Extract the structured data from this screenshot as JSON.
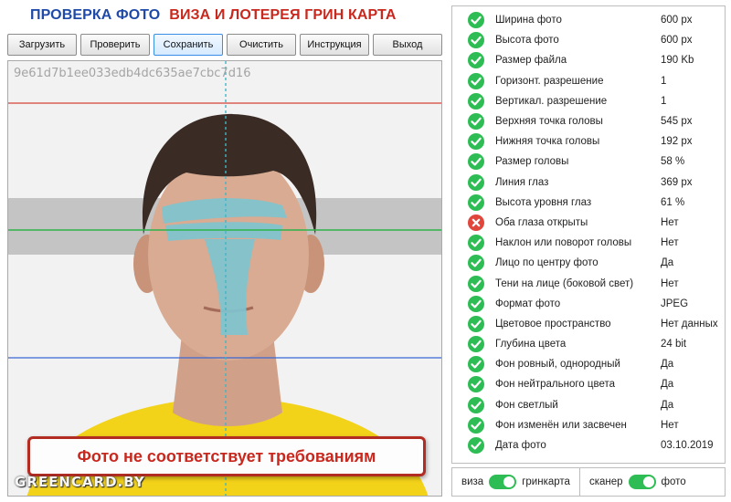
{
  "header": {
    "title_primary": "ПРОВЕРКА ФОТО",
    "title_secondary": "ВИЗА И ЛОТЕРЕЯ ГРИН КАРТА"
  },
  "toolbar": {
    "load_label": "Загрузить",
    "check_label": "Проверить",
    "save_label": "Сохранить",
    "clear_label": "Очистить",
    "instructions_label": "Инструкция",
    "exit_label": "Выход"
  },
  "photo": {
    "hash": "9e61d7b1ee033edb4dc635ae7cbc7d16",
    "status_message": "Фото не соответствует требованиям",
    "watermark": "GREENCARD.BY"
  },
  "results": [
    {
      "label": "Ширина фото",
      "value": "600 px",
      "status": "ok"
    },
    {
      "label": "Высота фото",
      "value": "600 px",
      "status": "ok"
    },
    {
      "label": "Размер файла",
      "value": "190 Kb",
      "status": "ok"
    },
    {
      "label": "Горизонт. разрешение",
      "value": "1",
      "status": "ok"
    },
    {
      "label": "Вертикал. разрешение",
      "value": "1",
      "status": "ok"
    },
    {
      "label": "Верхняя точка головы",
      "value": "545 px",
      "status": "ok"
    },
    {
      "label": "Нижняя точка головы",
      "value": "192 px",
      "status": "ok"
    },
    {
      "label": "Размер головы",
      "value": "58 %",
      "status": "ok"
    },
    {
      "label": "Линия глаз",
      "value": "369 px",
      "status": "ok"
    },
    {
      "label": "Высота уровня глаз",
      "value": "61 %",
      "status": "ok"
    },
    {
      "label": "Оба глаза открыты",
      "value": "Нет",
      "status": "fail"
    },
    {
      "label": "Наклон или поворот головы",
      "value": "Нет",
      "status": "ok"
    },
    {
      "label": "Лицо по центру фото",
      "value": "Да",
      "status": "ok"
    },
    {
      "label": "Тени на лице (боковой свет)",
      "value": "Нет",
      "status": "ok"
    },
    {
      "label": "Формат фото",
      "value": "JPEG",
      "status": "ok"
    },
    {
      "label": "Цветовое пространство",
      "value": "Нет данных",
      "status": "ok"
    },
    {
      "label": "Глубина цвета",
      "value": "24 bit",
      "status": "ok"
    },
    {
      "label": "Фон ровный, однородный",
      "value": "Да",
      "status": "ok"
    },
    {
      "label": "Фон нейтрального цвета",
      "value": "Да",
      "status": "ok"
    },
    {
      "label": "Фон светлый",
      "value": "Да",
      "status": "ok"
    },
    {
      "label": "Фон изменён или засвечен",
      "value": "Нет",
      "status": "ok"
    },
    {
      "label": "Дата фото",
      "value": "03.10.2019",
      "status": "ok"
    }
  ],
  "toggles": {
    "visa_label": "виза",
    "greencard_label": "гринкарта",
    "scanner_label": "сканер",
    "photo_label": "фото"
  },
  "colors": {
    "ok": "#2ebd54",
    "fail": "#e0463c",
    "title_blue": "#1f4aa8",
    "title_red": "#c8281e"
  }
}
